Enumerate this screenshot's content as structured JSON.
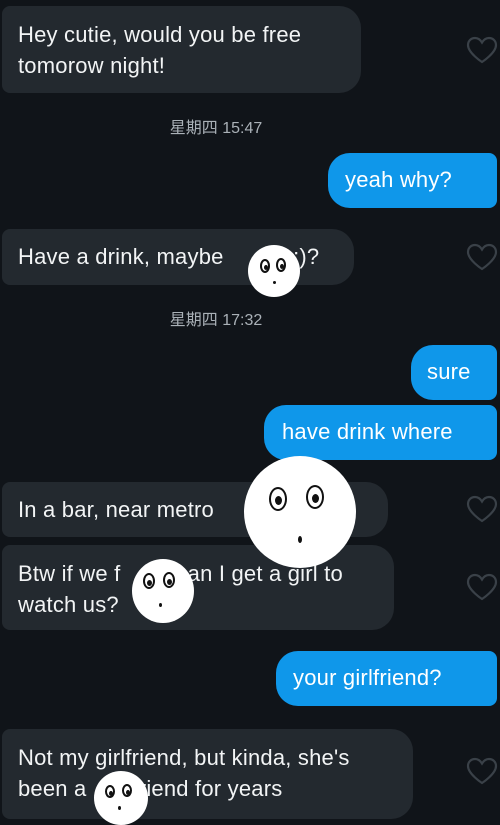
{
  "colors": {
    "background": "#101419",
    "incoming_bubble": "#23292f",
    "outgoing_bubble": "#0f97ea",
    "timestamp": "#aab1b7",
    "heart_outline": "#3a4148"
  },
  "messages": [
    {
      "id": "m1",
      "sender": "them",
      "lines": [
        "Hey cutie, would you be free",
        "tomorow night!"
      ]
    },
    {
      "id": "t1",
      "type": "timestamp",
      "text": "星期四 15:47"
    },
    {
      "id": "m2",
      "sender": "me",
      "lines": [
        "yeah why?"
      ]
    },
    {
      "id": "m3",
      "sender": "them",
      "lines": [
        "Have a drink, maybe",
        "k :)?"
      ]
    },
    {
      "id": "t2",
      "type": "timestamp",
      "text": "星期四 17:32"
    },
    {
      "id": "m4",
      "sender": "me",
      "lines": [
        "sure"
      ]
    },
    {
      "id": "m5",
      "sender": "me",
      "lines": [
        "have drink where"
      ]
    },
    {
      "id": "m6",
      "sender": "them",
      "lines": [
        "In a bar, near metro",
        "?"
      ]
    },
    {
      "id": "m7",
      "sender": "them",
      "lines": [
        "Btw if we f",
        "can I get a girl to",
        "watch us?"
      ]
    },
    {
      "id": "m8",
      "sender": "me",
      "lines": [
        "your girlfriend?"
      ]
    },
    {
      "id": "m9",
      "sender": "them",
      "lines": [
        "Not my girlfriend, but kinda, she's",
        "been a",
        "friend for years"
      ]
    }
  ],
  "icons": {
    "like": "heart-outline-icon",
    "censor": "cartoon-face-sticker"
  }
}
